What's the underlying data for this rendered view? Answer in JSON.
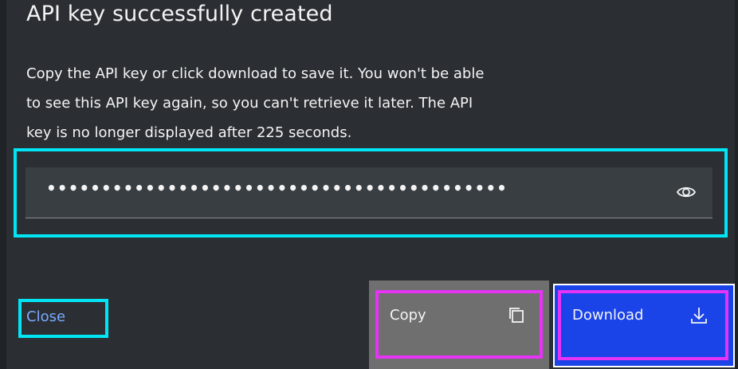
{
  "dialog": {
    "title": "API key successfully created",
    "body_lines": [
      "Copy the API key or click download to save it. You won't be able",
      "to see this API key again, so you can't retrieve it later. The API",
      "key is no longer displayed after 225 seconds."
    ],
    "api_key_masked": "••••••••••••••••••••••••••••••••••••••••••",
    "visibility_icon": "eye-icon"
  },
  "actions": {
    "close_label": "Close",
    "copy_label": "Copy",
    "copy_icon": "copy-icon",
    "download_label": "Download",
    "download_icon": "download-icon"
  },
  "colors": {
    "background": "#2b2f33",
    "field": "#393e43",
    "link": "#78a9ff",
    "secondary_button": "#6f6f6f",
    "primary_button": "#1a43e8",
    "highlight_cyan": "#00e5f4",
    "highlight_magenta": "#e534f5"
  }
}
